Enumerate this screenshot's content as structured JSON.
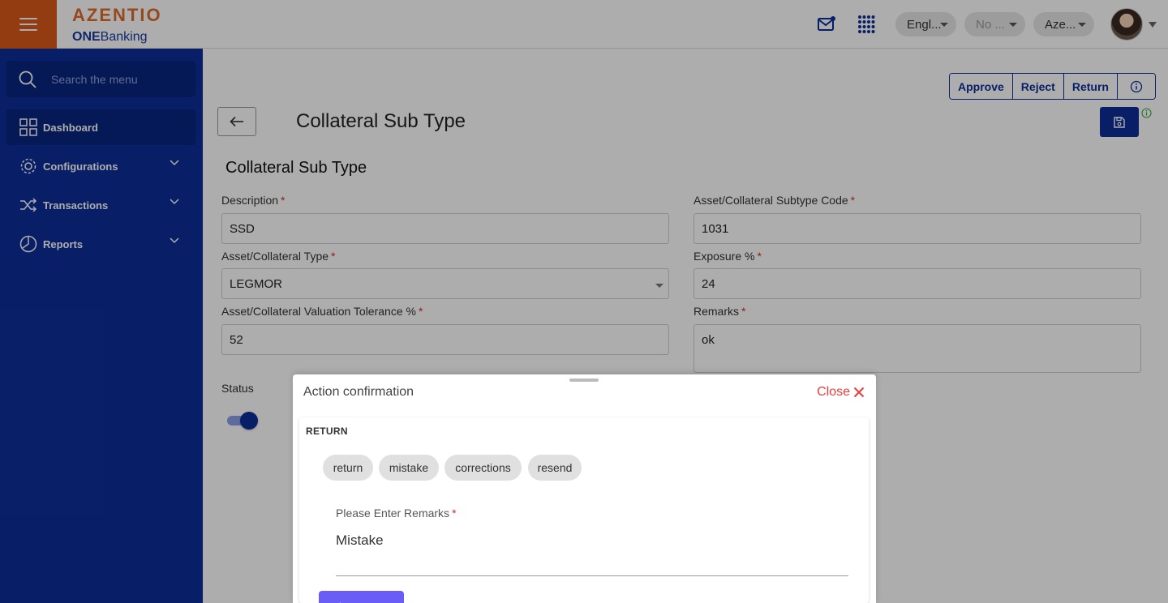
{
  "header": {
    "logo_main": "AZENTIO",
    "logo_sub_bold": "ONE",
    "logo_sub_rest": "Banking",
    "language": "Engl...",
    "branch": "No ...",
    "company": "Aze..."
  },
  "sidebar": {
    "search_placeholder": "Search the menu",
    "items": [
      {
        "label": "Dashboard",
        "icon": "dashboard-grid-icon"
      },
      {
        "label": "Configurations",
        "icon": "gear-icon"
      },
      {
        "label": "Transactions",
        "icon": "shuffle-icon"
      },
      {
        "label": "Reports",
        "icon": "pie-chart-icon"
      }
    ]
  },
  "toolbar": {
    "approve_label": "Approve",
    "reject_label": "Reject",
    "return_label": "Return"
  },
  "page": {
    "title": "Collateral Sub Type",
    "section_title": "Collateral Sub Type"
  },
  "form": {
    "description": {
      "label": "Description",
      "value": "SSD"
    },
    "subtype_code": {
      "label": "Asset/Collateral Subtype Code",
      "value": "1031"
    },
    "collateral_type": {
      "label": "Asset/Collateral Type",
      "value": "LEGMOR"
    },
    "exposure": {
      "label": "Exposure %",
      "value": "24"
    },
    "valuation_tolerance": {
      "label": "Asset/Collateral Valuation Tolerance %",
      "value": "52"
    },
    "remarks": {
      "label": "Remarks",
      "value": "ok"
    },
    "status": {
      "label": "Status",
      "enabled": true
    }
  },
  "dialog": {
    "title": "Action confirmation",
    "close_label": "Close",
    "section_label": "RETURN",
    "chips": [
      "return",
      "mistake",
      "corrections",
      "resend"
    ],
    "remarks_label": "Please Enter Remarks",
    "remarks_value": "Mistake"
  },
  "colors": {
    "brand_orange": "#d9581a",
    "sidebar_blue": "#0d2f9a",
    "close_red": "#ef3d3d",
    "submit_purple": "#6a5cf6"
  }
}
